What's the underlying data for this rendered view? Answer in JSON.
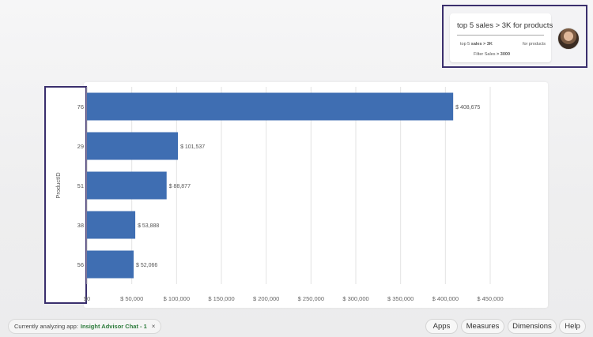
{
  "query": {
    "title": "top 5 sales > 3K for products",
    "left_prefix": "top 5 ",
    "left_bold": "sales > 3K",
    "right_text": "for products",
    "filter_prefix": "Filter Sales ",
    "filter_bold": "> 3000"
  },
  "chart_data": {
    "type": "bar",
    "orientation": "horizontal",
    "categories": [
      "76",
      "29",
      "51",
      "38",
      "56"
    ],
    "values": [
      408675,
      101537,
      88877,
      53888,
      52066
    ],
    "value_labels": [
      "$ 408,675",
      "$ 101,537",
      "$ 88,877",
      "$ 53,888",
      "$ 52,066"
    ],
    "ylabel": "ProductID",
    "xlim": [
      0,
      450000
    ],
    "x_ticks": [
      0,
      50000,
      100000,
      150000,
      200000,
      250000,
      300000,
      350000,
      400000,
      450000
    ],
    "x_tick_labels": [
      "$0",
      "$ 50,000",
      "$ 100,000",
      "$ 150,000",
      "$ 200,000",
      "$ 250,000",
      "$ 300,000",
      "$ 350,000",
      "$ 400,000",
      "$ 450,000"
    ],
    "grid": true,
    "bar_color": "#3f6eb2"
  },
  "footer": {
    "status_prefix": "Currently analyzing app:",
    "app_name": "Insight Advisor Chat - 1",
    "close_glyph": "×",
    "apps_label": "Apps",
    "measures_label": "Measures",
    "dimensions_label": "Dimensions",
    "help_label": "Help"
  }
}
